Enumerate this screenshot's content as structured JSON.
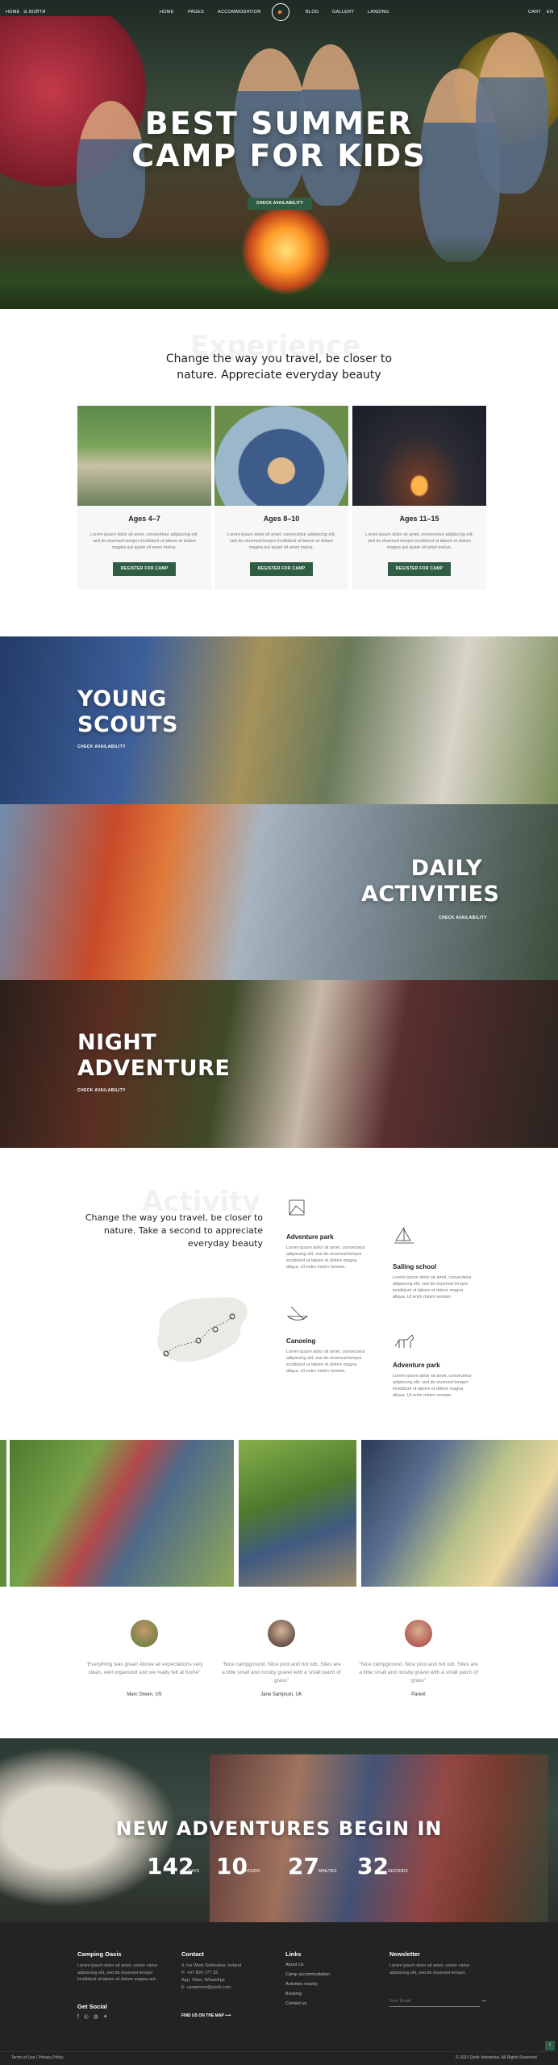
{
  "nav": {
    "home": "HOME",
    "menu_icon_label": "☰ ВОЙТИ",
    "items": [
      "HOME",
      "PAGES",
      "ACCOMMODATION",
      "BLOG",
      "GALLERY",
      "LANDING"
    ],
    "cart": "CART",
    "lang": "EN"
  },
  "hero": {
    "title_line1": "BEST SUMMER",
    "title_line2": "CAMP FOR KIDS",
    "cta": "CHECK AVAILABILITY"
  },
  "experience": {
    "ghost": "Experience",
    "heading": "Change the way you travel, be closer to nature. Appreciate everyday beauty",
    "cards": [
      {
        "title": "Ages 4–7",
        "desc": "Lorem ipsum dolor sit amet, consectetur adipiscing elit, sed do eiusmod tempor incididunt ut labore et dolore magna aut quam sit amet metus.",
        "cta": "REGISTER FOR CAMP"
      },
      {
        "title": "Ages 8–10",
        "desc": "Lorem ipsum dolor sit amet, consectetur adipiscing elit, sed do eiusmod tempor incididunt ut labore et dolore magna aut quam sit amet metus.",
        "cta": "REGISTER FOR CAMP"
      },
      {
        "title": "Ages 11–15",
        "desc": "Lorem ipsum dolor sit amet, consectetur adipiscing elit, sed do eiusmod tempor incididunt ut labore et dolore magna aut quam sit amet metus.",
        "cta": "REGISTER FOR CAMP"
      }
    ]
  },
  "banners": [
    {
      "line1": "YOUNG",
      "line2": "SCOUTS",
      "cta": "CHECK AVAILABILITY"
    },
    {
      "line1": "DAILY",
      "line2": "ACTIVITIES",
      "cta": "CHECK AVAILABILITY"
    },
    {
      "line1": "NIGHT",
      "line2": "ADVENTURE",
      "cta": "CHECK AVAILABILITY"
    }
  ],
  "activity": {
    "ghost": "Activity",
    "heading": "Change the way you travel, be closer to nature. Take a second to appreciate everyday beauty",
    "items": [
      {
        "title": "Adventure park",
        "desc": "Lorem ipsum dolor sit amet, consectetur adipiscing elit, sed do eiusmod tempor incididunt ut labore et dolore magna aliqua. Ut enim minim veniam."
      },
      {
        "title": "Sailing school",
        "desc": "Lorem ipsum dolor sit amet, consectetur adipiscing elit, sed do eiusmod tempor incididunt ut labore et dolore magna aliqua. Ut enim minim veniam."
      },
      {
        "title": "Canoeing",
        "desc": "Lorem ipsum dolor sit amet, consectetur adipiscing elit, sed do eiusmod tempor incididunt ut labore et dolore magna aliqua. Ut enim minim veniam."
      },
      {
        "title": "Adventure park",
        "desc": "Lorem ipsum dolor sit amet, consectetur adipiscing elit, sed do eiusmod tempor incididunt ut labore et dolore magna aliqua. Ut enim minim veniam."
      }
    ]
  },
  "testimonials": [
    {
      "quote": "\"Everything was great! Above all expectations very clean, well organized and we really felt at home\"",
      "name": "Marc Green, US"
    },
    {
      "quote": "\"Nice campground. Nice pool and hot tub. Sites are a little small and mostly gravel with a small patch of grass\"",
      "name": "Jane Sampson, UK"
    },
    {
      "quote": "\"Nice campground. Nice pool and hot tub. Sites are a little small and mostly gravel with a small patch of grass\"",
      "name": "Parent"
    }
  ],
  "countdown": {
    "title": "NEW ADVENTURES BEGIN IN",
    "items": [
      {
        "value": "142",
        "unit": "DAYS"
      },
      {
        "value": "10",
        "unit": "HOURS"
      },
      {
        "value": "27",
        "unit": "MINUTES"
      },
      {
        "value": "32",
        "unit": "SECONDS"
      }
    ]
  },
  "footer": {
    "about": {
      "title": "Camping Oasis",
      "text": "Lorem ipsum dolor sit amet, conse ctetur adipiscing elit, sed do eiusmod tempor incididunt ut labore et dolore magna aut."
    },
    "social_title": "Get Social",
    "contact": {
      "title": "Contact",
      "lines": [
        "4. Ive Work Sothoebar, Ireland",
        "P: +97 800 777 33",
        "App: Viber, WhatsApp",
        "E: campinmx@yoob.com"
      ],
      "map_link": "FIND US ON THE MAP"
    },
    "links": {
      "title": "Links",
      "items": [
        "About Us",
        "Camp accommodation",
        "Activities nearby",
        "Booking",
        "Contact us"
      ]
    },
    "newsletter": {
      "title": "Newsletter",
      "text": "Lorem ipsum dolor sit amet, conse ctetur adipiscing elit, sed do eiusmod tempor.",
      "placeholder": "Your Email"
    },
    "bottom_left": "Terms of Use | Privacy Policy",
    "bottom_right": "© 2023 Qode Interactive, All Rights Reserved"
  }
}
